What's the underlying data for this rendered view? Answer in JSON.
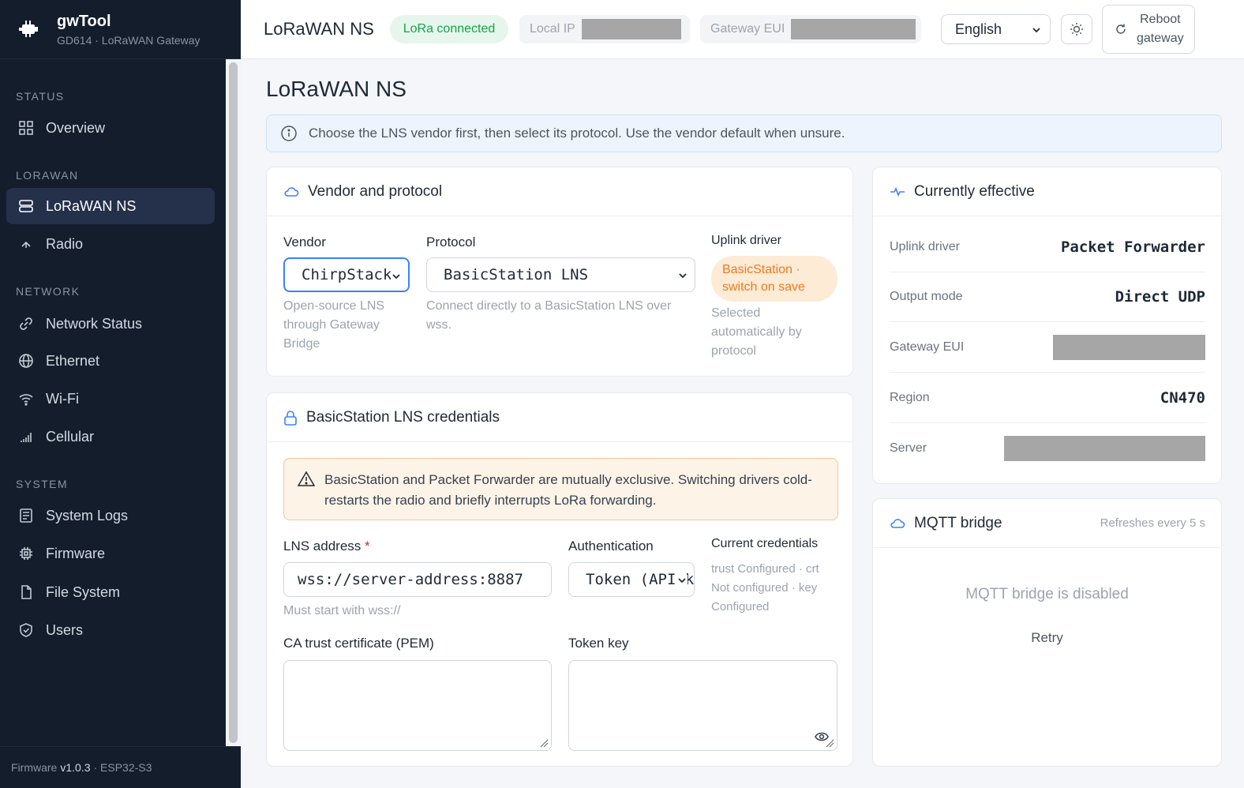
{
  "brand": {
    "name": "gwTool",
    "subtitle": "GD614 · LoRaWAN Gateway"
  },
  "sidebar": {
    "sections": [
      {
        "title": "STATUS",
        "items": [
          {
            "label": "Overview",
            "icon": "grid-icon"
          }
        ]
      },
      {
        "title": "LORAWAN",
        "items": [
          {
            "label": "LoRaWAN NS",
            "icon": "server-icon",
            "active": true
          },
          {
            "label": "Radio",
            "icon": "radio-icon"
          }
        ]
      },
      {
        "title": "NETWORK",
        "items": [
          {
            "label": "Network Status",
            "icon": "link-icon"
          },
          {
            "label": "Ethernet",
            "icon": "globe-icon"
          },
          {
            "label": "Wi-Fi",
            "icon": "wifi-icon"
          },
          {
            "label": "Cellular",
            "icon": "signal-icon"
          }
        ]
      },
      {
        "title": "SYSTEM",
        "items": [
          {
            "label": "System Logs",
            "icon": "log-icon"
          },
          {
            "label": "Firmware",
            "icon": "chip-icon"
          },
          {
            "label": "File System",
            "icon": "file-icon"
          },
          {
            "label": "Users",
            "icon": "shield-icon"
          }
        ]
      }
    ],
    "footer": {
      "prefix": "Firmware",
      "version": "v1.0.3",
      "suffix": "· ESP32-S3"
    }
  },
  "topbar": {
    "title": "LoRaWAN NS",
    "status": "LoRa connected",
    "local_ip_label": "Local IP",
    "gateway_eui_label": "Gateway EUI",
    "language": "English",
    "reboot_line1": "Reboot",
    "reboot_line2": "gateway",
    "status_color": "#16a34a"
  },
  "main": {
    "page_title": "LoRaWAN NS",
    "info": "Choose the LNS vendor first, then select its protocol. Use the vendor default when unsure."
  },
  "vendor_card": {
    "title": "Vendor and protocol",
    "vendor_label": "Vendor",
    "vendor_value": "ChirpStack",
    "vendor_hint": "Open-source LNS through Gateway Bridge",
    "protocol_label": "Protocol",
    "protocol_value": "BasicStation LNS",
    "protocol_hint": "Connect directly to a BasicStation LNS over wss.",
    "uplink_label": "Uplink driver",
    "uplink_pill": "BasicStation · switch on save",
    "uplink_hint": "Selected automatically by protocol"
  },
  "cred_card": {
    "title": "BasicStation LNS credentials",
    "warning": "BasicStation and Packet Forwarder are mutually exclusive. Switching drivers cold-restarts the radio and briefly interrupts LoRa forwarding.",
    "lns_label": "LNS address",
    "lns_required": "*",
    "lns_value": "wss://server-address:8887",
    "lns_hint": "Must start with wss://",
    "auth_label": "Authentication",
    "auth_value": "Token (API key)",
    "cur_cred_label": "Current credentials",
    "cur_cred_text": "trust Configured · crt Not configured · key Configured",
    "ca_label": "CA trust certificate (PEM)",
    "token_label": "Token key"
  },
  "effective_card": {
    "title": "Currently effective",
    "rows": [
      {
        "k": "Uplink driver",
        "v": "Packet Forwarder"
      },
      {
        "k": "Output mode",
        "v": "Direct UDP"
      },
      {
        "k": "Gateway EUI",
        "v": ""
      },
      {
        "k": "Region",
        "v": "CN470"
      },
      {
        "k": "Server",
        "v": ""
      }
    ]
  },
  "mqtt_card": {
    "title": "MQTT bridge",
    "refresh": "Refreshes every 5 s",
    "empty": "MQTT bridge is disabled",
    "retry": "Retry"
  },
  "colors": {
    "accent": "#3b82f6",
    "sidebar_bg": "#141d2c",
    "warn": "#ea7c1c"
  }
}
